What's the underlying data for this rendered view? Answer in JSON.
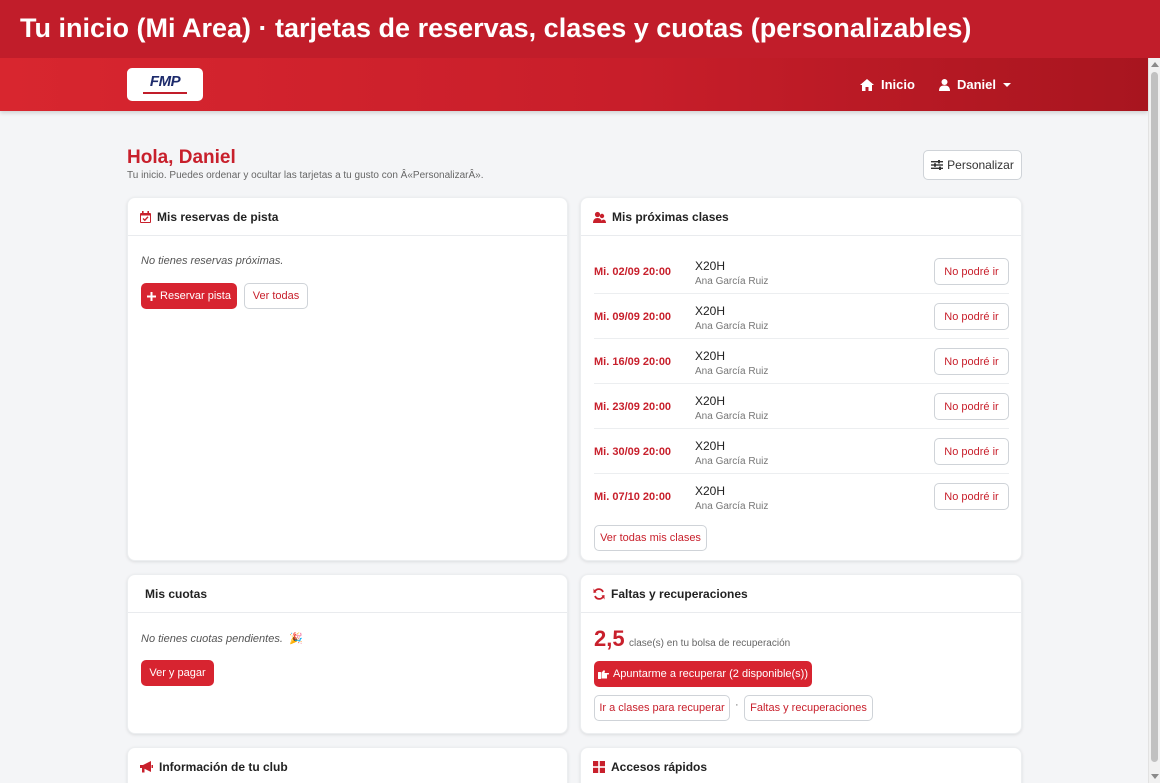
{
  "window_title": "Tu inicio (Mi Area) · tarjetas de reservas, clases y cuotas (personalizables)",
  "navbar": {
    "logo_text": "FMP",
    "inicio_label": "Inicio",
    "user_label": "Daniel"
  },
  "page": {
    "greeting": "Hola, Daniel",
    "subtitle": "Tu inicio. Puedes ordenar y ocultar las tarjetas a tu gusto con Â«PersonalizarÂ».",
    "personalizar_label": "Personalizar"
  },
  "reservas": {
    "title": "Mis reservas de pista",
    "empty": "No tienes reservas próximas.",
    "reservar_label": "Reservar pista",
    "ver_todas_label": "Ver todas"
  },
  "clases": {
    "title": "Mis próximas clases",
    "items": [
      {
        "date": "Mi. 02/09 20:00",
        "name": "X20H",
        "teacher": "Ana García Ruiz",
        "action": "No podré ir"
      },
      {
        "date": "Mi. 09/09 20:00",
        "name": "X20H",
        "teacher": "Ana García Ruiz",
        "action": "No podré ir"
      },
      {
        "date": "Mi. 16/09 20:00",
        "name": "X20H",
        "teacher": "Ana García Ruiz",
        "action": "No podré ir"
      },
      {
        "date": "Mi. 23/09 20:00",
        "name": "X20H",
        "teacher": "Ana García Ruiz",
        "action": "No podré ir"
      },
      {
        "date": "Mi. 30/09 20:00",
        "name": "X20H",
        "teacher": "Ana García Ruiz",
        "action": "No podré ir"
      },
      {
        "date": "Mi. 07/10 20:00",
        "name": "X20H",
        "teacher": "Ana García Ruiz",
        "action": "No podré ir"
      }
    ],
    "ver_todas_label": "Ver todas mis clases"
  },
  "cuotas": {
    "title": "Mis cuotas",
    "empty": "No tienes cuotas pendientes.",
    "emoji": "🎉",
    "pagar_label": "Ver y pagar"
  },
  "faltas": {
    "title": "Faltas y recuperaciones",
    "count": "2,5",
    "bolsa_text": "clase(s) en tu bolsa de recuperación",
    "apuntarme_label": "Apuntarme a recuperar (2 disponible(s))",
    "ir_clases_label": "Ir a clases para recuperar",
    "separator": "·",
    "faltas_label": "Faltas y recuperaciones"
  },
  "info": {
    "title": "Información de tu club"
  },
  "accesos": {
    "title": "Accesos rápidos"
  },
  "colors": {
    "brand_red": "#c8202c",
    "button_red": "#d72430"
  }
}
